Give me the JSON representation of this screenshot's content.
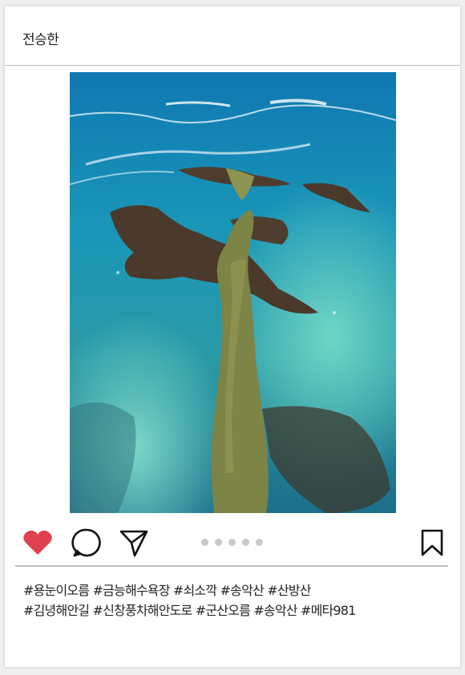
{
  "post": {
    "username": "전승한",
    "image": {
      "subject": "aerial-ocean-causeway-photo",
      "colors": [
        "#1f86b0",
        "#35b7b5",
        "#5e4a36",
        "#7a8a48"
      ]
    },
    "actions": {
      "like_state": "liked",
      "like_color": "#e0414f",
      "icons": [
        "heart-icon",
        "comment-icon",
        "share-icon",
        "bookmark-icon"
      ]
    },
    "carousel": {
      "count": 5,
      "dot_color": "#c9c9c9"
    },
    "caption_lines": [
      "#용눈이오름 #금능해수욕장 #쇠소깍 #송악산 #산방산",
      "#김녕해안길 #신창풍차해안도로 #군산오름 #송악산 #메타981"
    ]
  }
}
